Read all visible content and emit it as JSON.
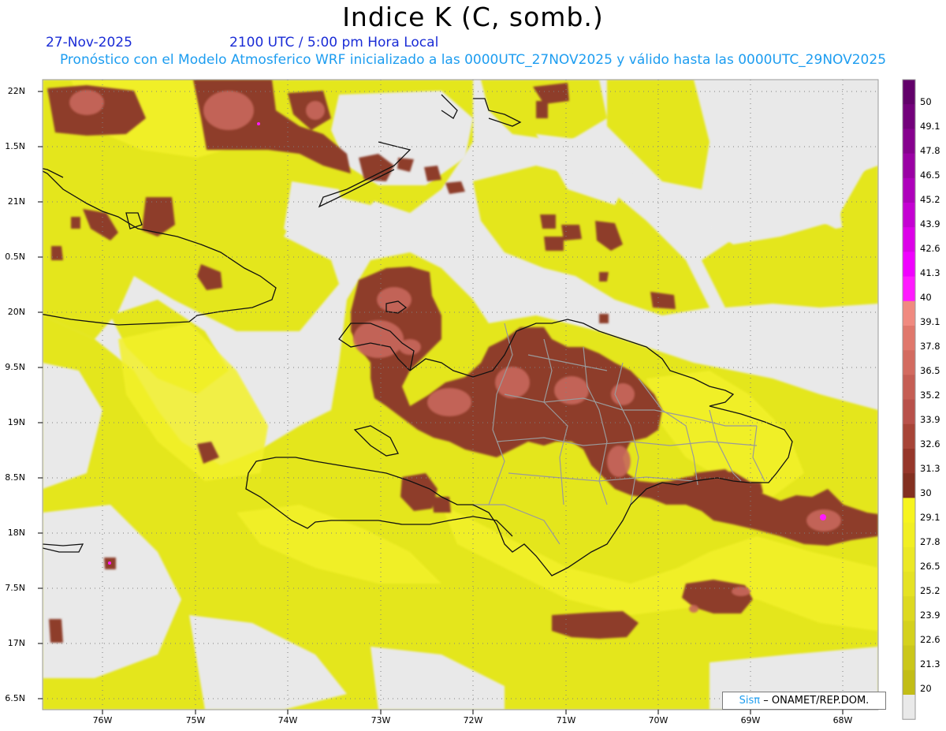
{
  "header": {
    "title": "Indice K (C, somb.)",
    "date": "27-Nov-2025",
    "time": "2100 UTC / 5:00 pm Hora Local",
    "model_info": "Pronóstico con el Modelo Atmosferico WRF inicializado a las 0000UTC_27NOV2025 y válido hasta las  0000UTC_29NOV2025"
  },
  "map": {
    "lat_labels": [
      "22N",
      "1.5N",
      "21N",
      "0.5N",
      "20N",
      "9.5N",
      "19N",
      "8.5N",
      "18N",
      "7.5N",
      "17N",
      "6.5N"
    ],
    "lon_labels": [
      "76W",
      "75W",
      "74W",
      "73W",
      "72W",
      "71W",
      "70W",
      "69W",
      "68W"
    ],
    "colors": {
      "background": "#e9e9e9",
      "frame": "#9a9a9a",
      "coastline": "#111111",
      "provinces": "#9a9a9a",
      "low_yellow": "#e4e61e",
      "bright_yellow": "#f3f12c",
      "dark_red": "#8e3d2c",
      "salmon": "#c8675c",
      "magenta": "#ff19ff"
    }
  },
  "colorbar": {
    "labels": [
      "50",
      "49.1",
      "47.8",
      "46.5",
      "45.2",
      "43.9",
      "42.6",
      "41.3",
      "40",
      "39.1",
      "37.8",
      "36.5",
      "35.2",
      "33.9",
      "32.6",
      "31.3",
      "30",
      "29.1",
      "27.8",
      "26.5",
      "25.2",
      "23.9",
      "22.6",
      "21.3",
      "20"
    ],
    "colors": [
      "#62006a",
      "#73007b",
      "#86008e",
      "#9a00a4",
      "#ae00bb",
      "#c400d2",
      "#dc00e8",
      "#f000ff",
      "#ff1aff",
      "#f08a80",
      "#e0786c",
      "#d36b60",
      "#c55e54",
      "#b8514a",
      "#a74437",
      "#96372a",
      "#833020",
      "#f6f41e",
      "#f1ef23",
      "#ebe825",
      "#e5e223",
      "#ddd920",
      "#d4d11d",
      "#cbc71a",
      "#c2bd16",
      "#e9e9e9"
    ]
  },
  "credit": {
    "sis": "Sisπ",
    "org": "– ONAMET/REP.DOM."
  }
}
